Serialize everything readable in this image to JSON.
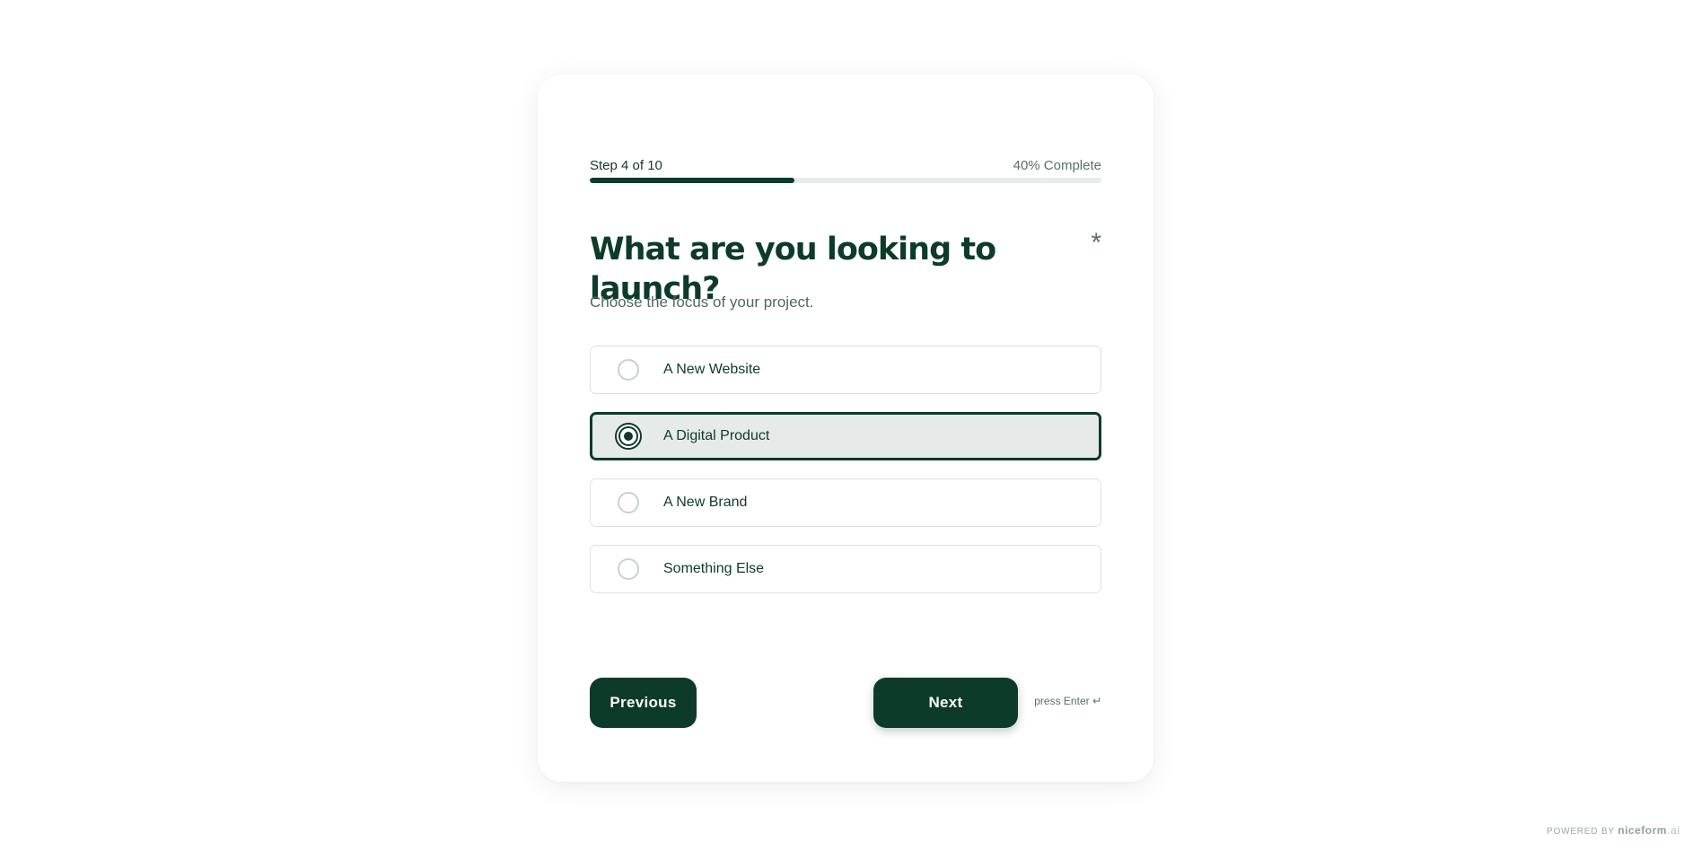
{
  "progress": {
    "step_label": "Step 4 of 10",
    "percent_label": "40% Complete",
    "fraction": 0.4
  },
  "question": {
    "title": "What are you looking to launch?",
    "required_mark": "*",
    "subtitle": "Choose the focus of your project."
  },
  "options": [
    {
      "label": "A New Website",
      "selected": false
    },
    {
      "label": "A Digital Product",
      "selected": true
    },
    {
      "label": "A New Brand",
      "selected": false
    },
    {
      "label": "Something Else",
      "selected": false
    }
  ],
  "nav": {
    "previous_label": "Previous",
    "next_label": "Next",
    "hint": "press Enter ↵"
  },
  "footer": {
    "powered_by": "POWERED BY",
    "brand": "niceform",
    "brand_tld": ".ai"
  },
  "colors": {
    "accent": "#0d3b2a",
    "selected_bg": "#e6ebea",
    "muted_text": "#56706a"
  }
}
